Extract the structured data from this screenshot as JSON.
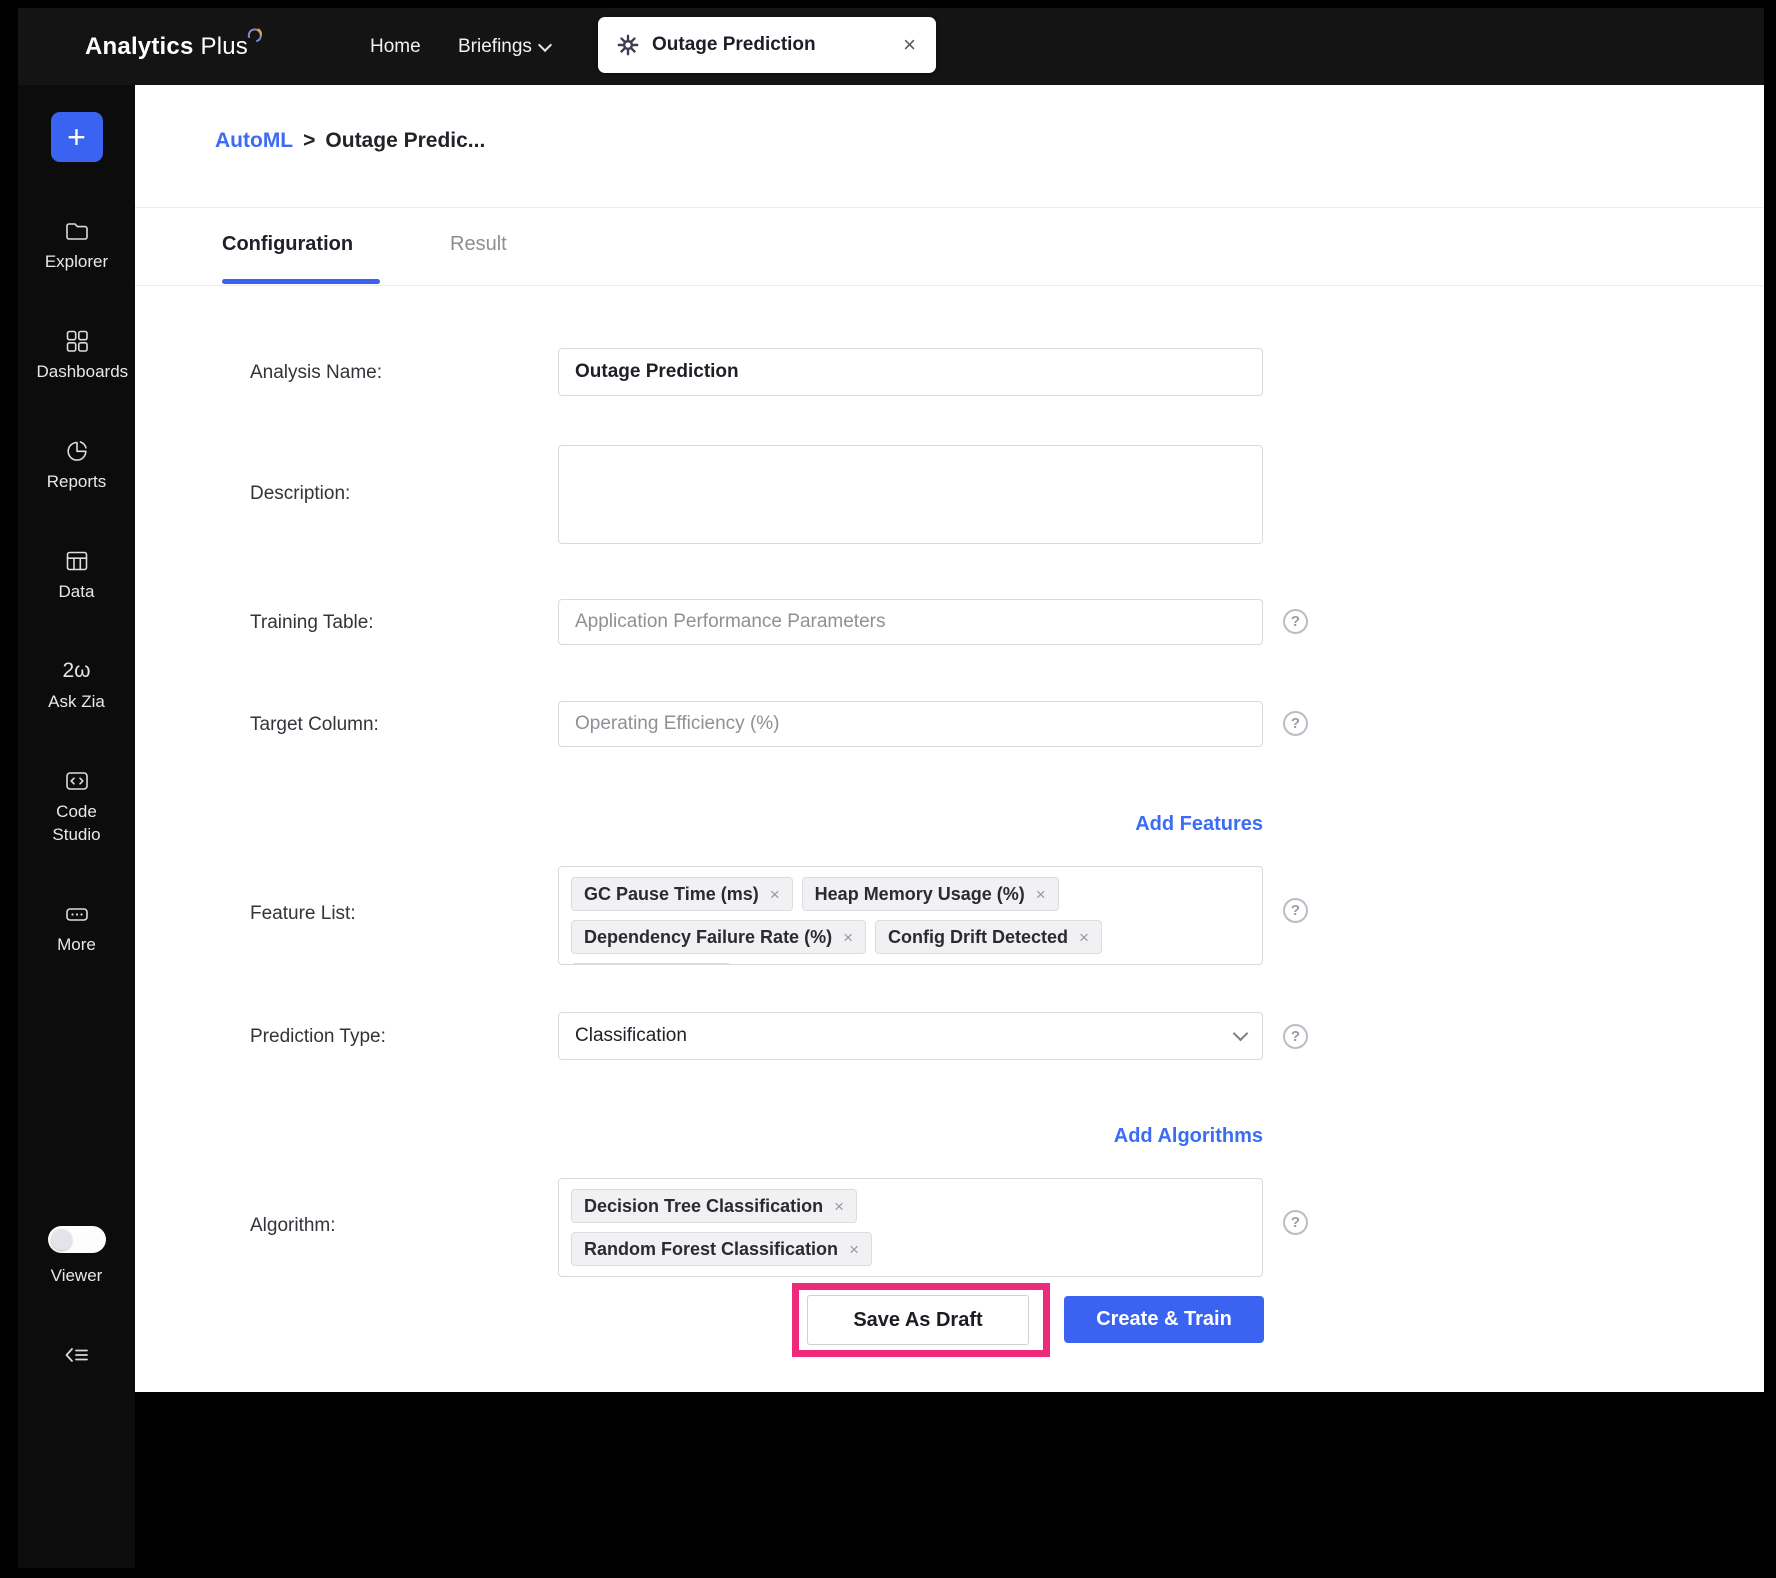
{
  "topbar": {
    "brand_bold": "Analytics",
    "brand_light": "Plus",
    "nav_home": "Home",
    "nav_briefings": "Briefings",
    "tab_label": "Outage Prediction"
  },
  "sidebar": {
    "items": [
      {
        "label": "Explorer"
      },
      {
        "label": "Dashboards"
      },
      {
        "label": "Reports"
      },
      {
        "label": "Data"
      },
      {
        "label": "Ask Zia"
      },
      {
        "label": "Code Studio"
      },
      {
        "label": "More"
      }
    ],
    "viewer_label": "Viewer"
  },
  "breadcrumb": {
    "root": "AutoML",
    "separator": ">",
    "current": "Outage Predic..."
  },
  "tabs": {
    "configuration": "Configuration",
    "result": "Result"
  },
  "form": {
    "analysis_name_label": "Analysis Name:",
    "analysis_name_value": "Outage Prediction",
    "description_label": "Description:",
    "training_table_label": "Training Table:",
    "training_table_placeholder": "Application Performance Parameters",
    "target_column_label": "Target Column:",
    "target_column_placeholder": "Operating Efficiency (%)",
    "add_features_link": "Add Features",
    "feature_list_label": "Feature List:",
    "feature_chips": [
      "GC Pause Time (ms)",
      "Heap Memory Usage (%)",
      "Dependency Failure Rate (%)",
      "Config Drift Detected"
    ],
    "prediction_type_label": "Prediction Type:",
    "prediction_type_value": "Classification",
    "add_algorithms_link": "Add Algorithms",
    "algorithm_label": "Algorithm:",
    "algorithm_chips": [
      "Decision Tree Classification",
      "Random Forest Classification"
    ]
  },
  "actions": {
    "save_draft": "Save As Draft",
    "create_train": "Create & Train"
  },
  "icons": {
    "plus": "+",
    "close": "×",
    "chip_remove": "×",
    "help": "?",
    "zia_glyph": "2ω"
  },
  "colors": {
    "accent_blue": "#3b63f2",
    "highlight_pink": "#ee2b7b"
  }
}
